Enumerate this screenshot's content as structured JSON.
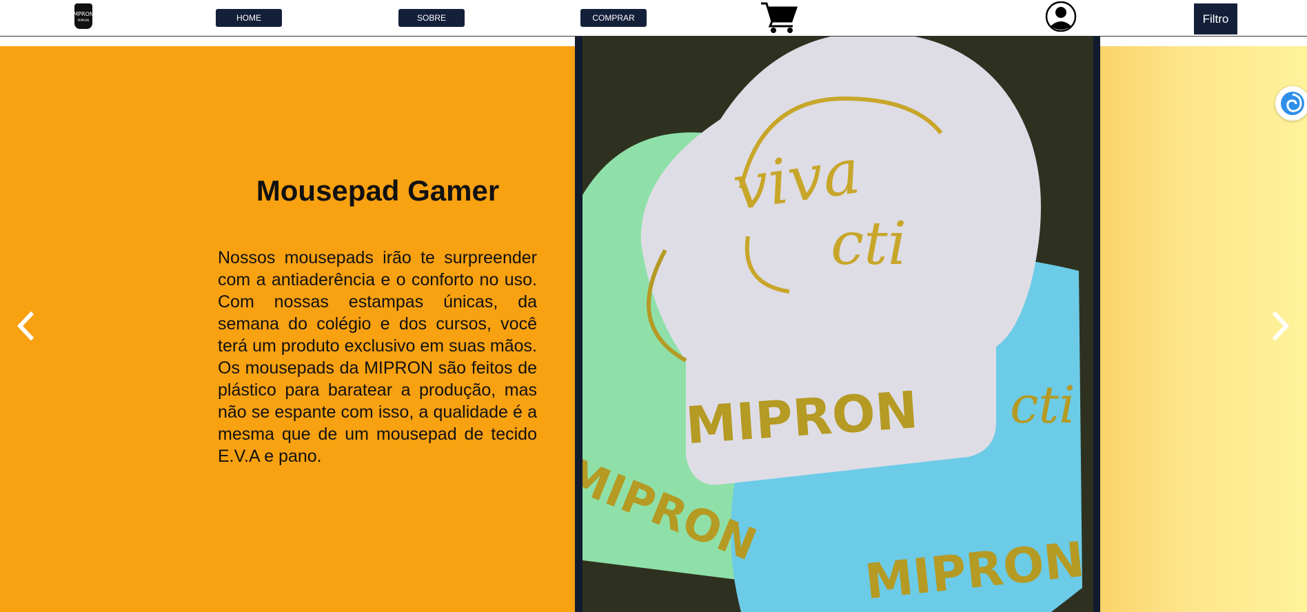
{
  "nav": {
    "logo_text": "MPRON",
    "logo_sub": "MIPRON",
    "home_label": "HOME",
    "sobre_label": "SOBRE",
    "comprar_label": "COMPRAR",
    "filtro_label": "Filtro",
    "cart_icon": "cart-icon",
    "user_icon": "user-account-icon",
    "accent": "#14203a"
  },
  "slide": {
    "title": "Mousepad Gamer",
    "description": "Nossos mousepads irão te surpreender com a antiaderência e o conforto no uso. Com nossas estampas únicas, da semana do colégio e dos cursos, você terá um produto exclusivo em suas mãos. Os mousepads da MIPRON são feitos de plástico para baratear a produção, mas não se espante com isso, a qualidade é a mesma que de um mousepad de tecido E.V.A e pano.",
    "background": "#f8a111",
    "photo_text": {
      "brand": "MIPRON",
      "line1": "viva",
      "line2": "cti"
    },
    "prev_icon": "chevron-left-icon",
    "next_icon": "chevron-right-icon"
  },
  "floating_button_icon": "swirl-extension-icon"
}
